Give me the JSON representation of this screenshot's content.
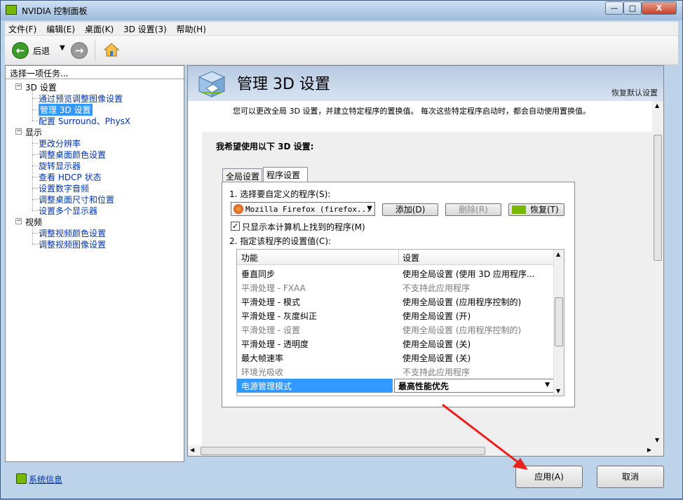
{
  "window": {
    "title": "NVIDIA 控制面板",
    "min": "—",
    "max": "□",
    "close": "X"
  },
  "menu": [
    "文件(F)",
    "编辑(E)",
    "桌面(K)",
    "3D 设置(3)",
    "帮助(H)"
  ],
  "toolbar": {
    "back_label": "后退"
  },
  "left": {
    "header": "选择一项任务...",
    "categories": [
      {
        "label": "3D 设置",
        "items": [
          "通过预览调整图像设置",
          "管理 3D 设置",
          "配置 Surround、PhysX"
        ]
      },
      {
        "label": "显示",
        "items": [
          "更改分辨率",
          "调整桌面颜色设置",
          "旋转显示器",
          "查看 HDCP 状态",
          "设置数字音频",
          "调整桌面尺寸和位置",
          "设置多个显示器"
        ]
      },
      {
        "label": "视频",
        "items": [
          "调整视频颜色设置",
          "调整视频图像设置"
        ]
      }
    ],
    "selected": "管理 3D 设置"
  },
  "main": {
    "title": "管理 3D 设置",
    "restore_defaults": "恢复默认设置",
    "description": "您可以更改全局 3D 设置，并建立特定程序的置换值。 每次这些特定程序启动时，都会自动使用置换值。",
    "panel_label": "我希望使用以下 3D 设置:",
    "tabs": [
      "全局设置",
      "程序设置"
    ],
    "step1_label": "1. 选择要自定义的程序(S):",
    "program_value": "Mozilla Firefox (firefox...",
    "add_btn": "添加(D)",
    "delete_btn": "删除(R)",
    "restore_btn": "恢复(T)",
    "checkbox_label": "只显示本计算机上找到的程序(M)",
    "step2_label": "2. 指定该程序的设置值(C):",
    "col_feature": "功能",
    "col_setting": "设置",
    "rows": [
      {
        "feature": "垂直同步",
        "setting": "使用全局设置 (使用 3D 应用程序...",
        "enabled": true
      },
      {
        "feature": "平滑处理 - FXAA",
        "setting": "不支持此应用程序",
        "enabled": false
      },
      {
        "feature": "平滑处理 - 模式",
        "setting": "使用全局设置 (应用程序控制的)",
        "enabled": true
      },
      {
        "feature": "平滑处理 - 灰度纠正",
        "setting": "使用全局设置 (开)",
        "enabled": true
      },
      {
        "feature": "平滑处理 - 设置",
        "setting": "使用全局设置 (应用程序控制的)",
        "enabled": false
      },
      {
        "feature": "平滑处理 - 透明度",
        "setting": "使用全局设置 (关)",
        "enabled": true
      },
      {
        "feature": "最大帧速率",
        "setting": "使用全局设置 (关)",
        "enabled": true
      },
      {
        "feature": "环境光吸收",
        "setting": "不支持此应用程序",
        "enabled": false
      },
      {
        "feature": "电源管理模式",
        "setting": "最高性能优先",
        "enabled": true,
        "selected": true
      }
    ]
  },
  "footer": {
    "system_info": "系统信息",
    "apply": "应用(A)",
    "cancel": "取消"
  },
  "colors": {
    "nvidia_green": "#76b900",
    "selection_blue": "#3399ff",
    "arrow_red": "#e8231c"
  }
}
